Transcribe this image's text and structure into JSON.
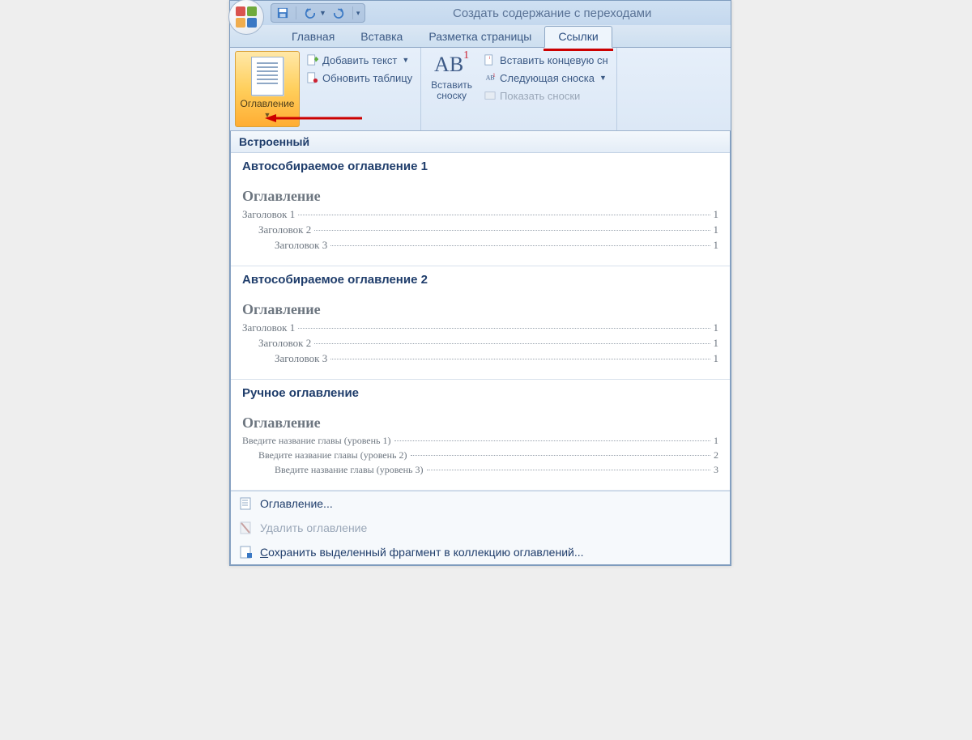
{
  "title": "Создать содержание с переходами",
  "tabs": [
    {
      "label": "Главная"
    },
    {
      "label": "Вставка"
    },
    {
      "label": "Разметка страницы"
    },
    {
      "label": "Ссылки",
      "active": true
    }
  ],
  "ribbon": {
    "toc": {
      "big_label": "Оглавление",
      "add_text": "Добавить текст",
      "update_table": "Обновить таблицу"
    },
    "footnotes": {
      "insert_label_l1": "Вставить",
      "insert_label_l2": "сноску",
      "insert_endnote": "Вставить концевую сн",
      "next_footnote": "Следующая сноска",
      "show_notes": "Показать сноски"
    }
  },
  "gallery": {
    "header": "Встроенный",
    "items": [
      {
        "title": "Автособираемое оглавление 1",
        "heading": "Оглавление",
        "lines": [
          {
            "level": 1,
            "label": "Заголовок 1",
            "page": "1"
          },
          {
            "level": 2,
            "label": "Заголовок 2",
            "page": "1"
          },
          {
            "level": 3,
            "label": "Заголовок 3",
            "page": "1"
          }
        ]
      },
      {
        "title": "Автособираемое оглавление 2",
        "heading": "Оглавление",
        "lines": [
          {
            "level": 1,
            "label": "Заголовок 1",
            "page": "1"
          },
          {
            "level": 2,
            "label": "Заголовок 2",
            "page": "1"
          },
          {
            "level": 3,
            "label": "Заголовок 3",
            "page": "1"
          }
        ]
      },
      {
        "title": "Ручное оглавление",
        "heading": "Оглавление",
        "lines": [
          {
            "level": 1,
            "label": "Введите название главы (уровень 1)",
            "page": "1"
          },
          {
            "level": 2,
            "label": "Введите название главы (уровень 2)",
            "page": "2"
          },
          {
            "level": 3,
            "label": "Введите название главы (уровень 3)",
            "page": "3"
          }
        ]
      }
    ],
    "footer": {
      "toc_dialog": "Оглавление...",
      "remove_toc": "Удалить оглавление",
      "save_selection": "Сохранить выделенный фрагмент в коллекцию оглавлений..."
    }
  }
}
